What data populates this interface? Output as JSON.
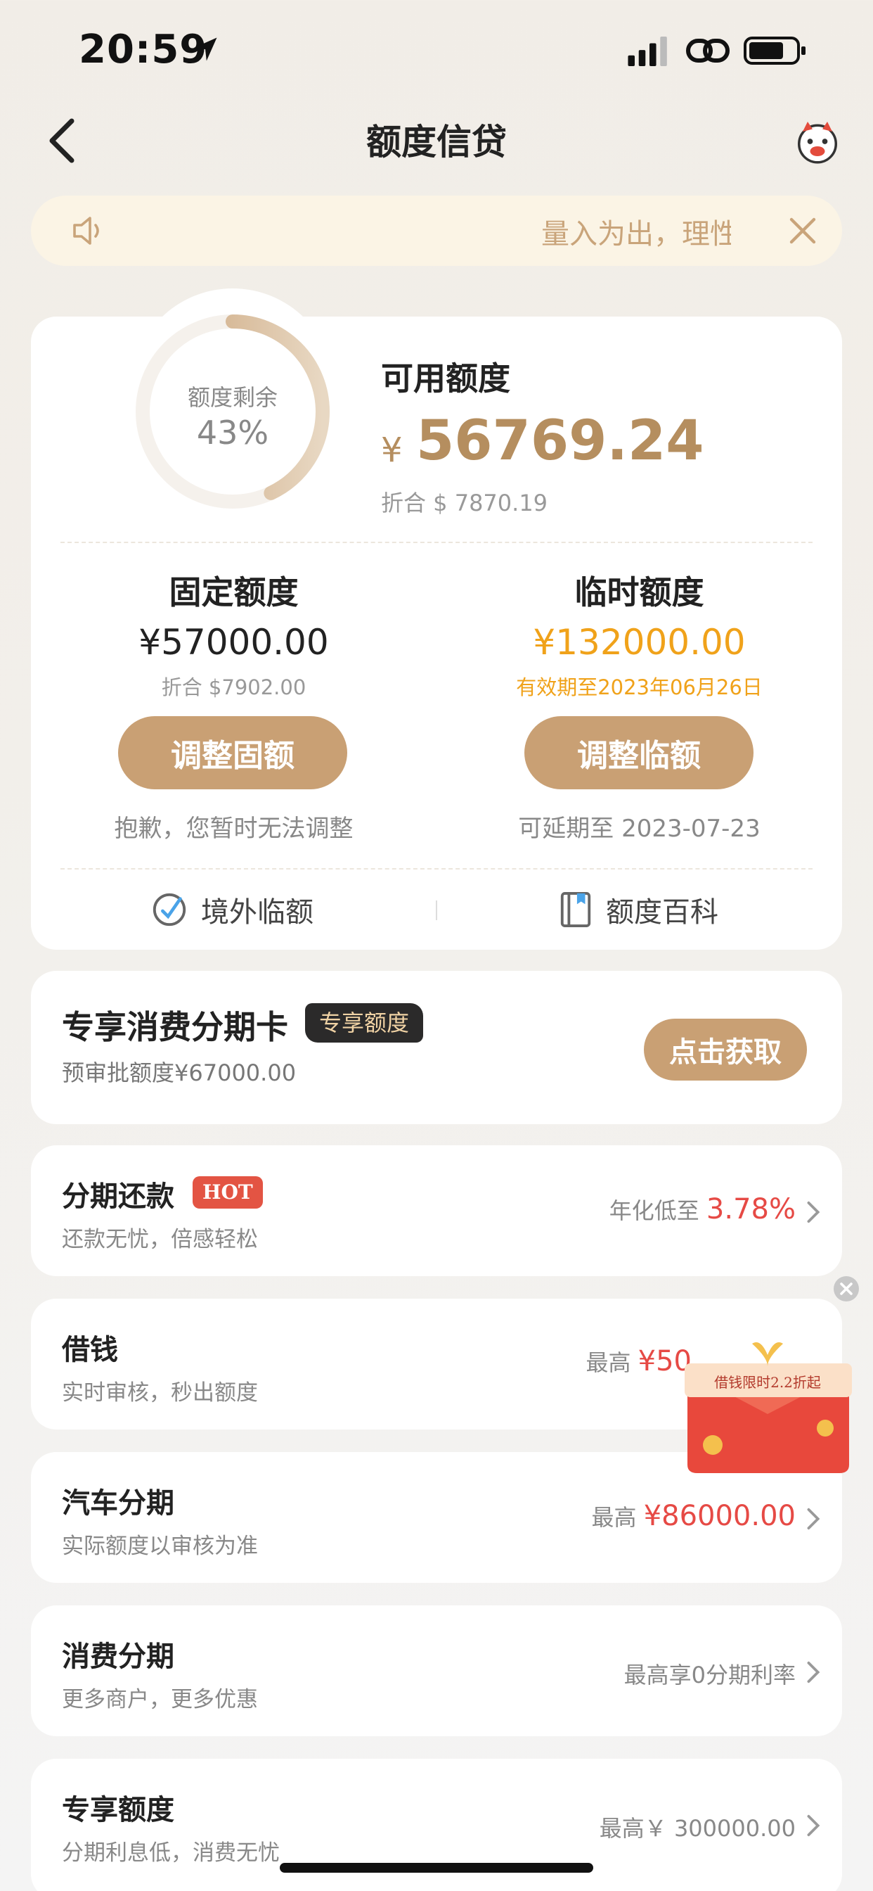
{
  "status_bar": {
    "time": "20:59"
  },
  "nav": {
    "title": "额度信贷"
  },
  "notice": {
    "text": "量入为出，理性"
  },
  "summary": {
    "ring_label": "额度剩余",
    "ring_percent": "43%",
    "ring_fraction": 0.43,
    "available_label": "可用额度",
    "currency": "¥",
    "available_amount": "56769.24",
    "available_converted": "折合 $ 7870.19"
  },
  "fixed": {
    "title": "固定额度",
    "amount": "¥57000.00",
    "converted": "折合 $7902.00",
    "button": "调整固额",
    "note": "抱歉，您暂时无法调整"
  },
  "temporary": {
    "title": "临时额度",
    "amount": "¥132000.00",
    "validity": "有效期至2023年06月26日",
    "button": "调整临额",
    "note": "可延期至 2023-07-23"
  },
  "links": {
    "overseas": "境外临额",
    "wiki": "额度百科"
  },
  "installment_card": {
    "title": "专享消费分期卡",
    "badge": "专享额度",
    "subtitle": "预审批额度¥67000.00",
    "button": "点击获取"
  },
  "rows": [
    {
      "title": "分期还款",
      "badge": "HOT",
      "subtitle": "还款无忧，倍感轻松",
      "right_label": "年化低至 ",
      "right_value": "3.78%"
    },
    {
      "title": "借钱",
      "subtitle": "实时审核，秒出额度",
      "right_label": "最高 ",
      "right_value": "¥50"
    },
    {
      "title": "汽车分期",
      "subtitle": "实际额度以审核为准",
      "right_label": "最高 ",
      "right_value": "¥86000.00"
    },
    {
      "title": "消费分期",
      "subtitle": "更多商户，更多优惠",
      "right_label": "最高享0分期利率",
      "right_value": ""
    },
    {
      "title": "专享额度",
      "subtitle": "分期利息低，消费无忧",
      "right_label": "最高￥ 300000.00",
      "right_value": ""
    }
  ],
  "promo": {
    "text": "借钱限时2.2折起"
  },
  "colors": {
    "gold": "#c9a074",
    "gold_text": "#b58e5f",
    "orange": "#f0a21a",
    "red": "#e64a45"
  }
}
